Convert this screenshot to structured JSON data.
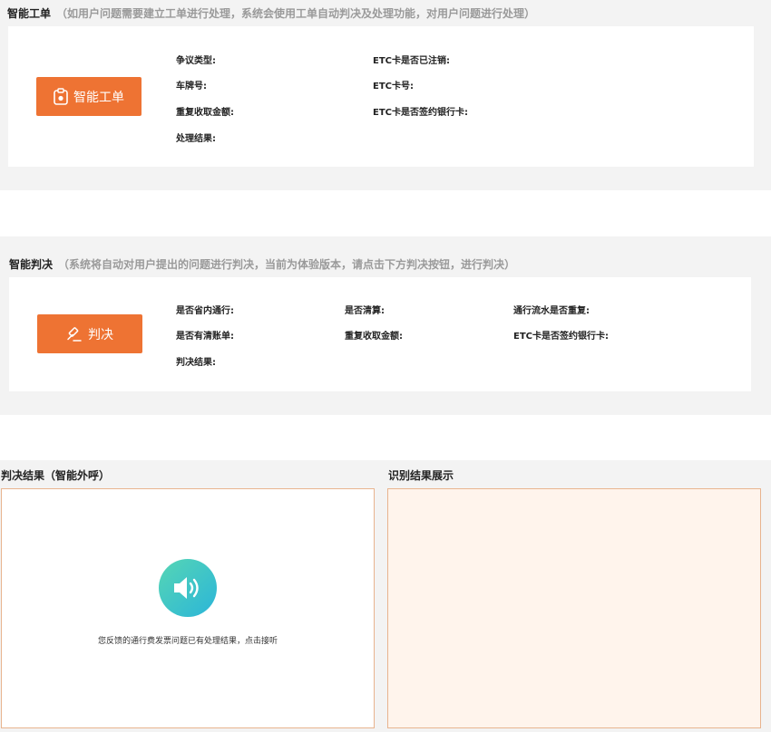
{
  "ticket": {
    "title": "智能工单",
    "hint": "（如用户问题需要建立工单进行处理，系统会使用工单自动判决及处理功能，对用户问题进行处理）",
    "button_label": "智能工单",
    "fields": {
      "dispute_type": "争议类型:",
      "etc_cancelled": "ETC卡是否已注销:",
      "plate_no": "车牌号:",
      "etc_card_no": "ETC卡号:",
      "duplicate_amount": "重复收取金额:",
      "etc_bank_signed": "ETC卡是否签约银行卡:",
      "result": "处理结果:"
    }
  },
  "judgement": {
    "title": "智能判决",
    "hint": "（系统将自动对用户提出的问题进行判决，当前为体验版本，请点击下方判决按钮，进行判决）",
    "button_label": "判决",
    "fields": {
      "in_province": "是否省内通行:",
      "is_cleared": "是否清算:",
      "flow_duplicate": "通行流水是否重复:",
      "has_statement": "是否有清账单:",
      "duplicate_amount": "重复收取金额:",
      "etc_bank_signed": "ETC卡是否签约银行卡:",
      "result": "判决结果:"
    }
  },
  "outcall": {
    "title": "判决结果（智能外呼）",
    "notice": "您反馈的通行费发票问题已有处理结果，点击接听"
  },
  "recognition": {
    "title": "识别结果展示"
  },
  "colors": {
    "accent": "#ee7333",
    "section_bg": "#f3f3f3",
    "panel_border": "#e8b48f",
    "recognition_bg": "#fff4ec",
    "speaker_gradient_start": "#56d6b4",
    "speaker_gradient_end": "#2bb5d9"
  },
  "icons": {
    "ticket_button": "clipboard-icon",
    "judgement_button": "gavel-icon",
    "speaker": "speaker-icon"
  }
}
